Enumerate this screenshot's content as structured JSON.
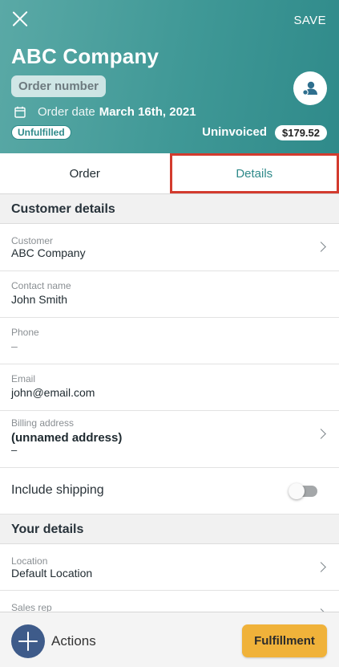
{
  "header": {
    "close_icon": "close-icon",
    "save_label": "SAVE",
    "company_name": "ABC Company",
    "order_number_label": "Order number",
    "avatar_icon": "person-icon",
    "calendar_icon": "calendar-icon",
    "order_date_label": "Order date",
    "order_date_value": "March 16th, 2021",
    "fulfillment_status": "Unfulfilled",
    "invoice_status": "Uninvoiced",
    "amount": "$179.52",
    "colors": {
      "accent": "#3f9896",
      "highlight_border": "#d33b2e"
    }
  },
  "tabs": [
    {
      "label": "Order",
      "selected": false
    },
    {
      "label": "Details",
      "selected": true
    }
  ],
  "customer_details": {
    "section_title": "Customer details",
    "customer": {
      "label": "Customer",
      "value": "ABC Company"
    },
    "contact": {
      "label": "Contact name",
      "value": "John Smith"
    },
    "phone": {
      "label": "Phone",
      "value": "–"
    },
    "email": {
      "label": "Email",
      "value": "john@email.com"
    },
    "billing": {
      "label": "Billing address",
      "title": "(unnamed address)",
      "value": "–"
    },
    "shipping": {
      "label": "Include shipping",
      "enabled": false
    }
  },
  "your_details": {
    "section_title": "Your details",
    "location": {
      "label": "Location",
      "value": "Default Location"
    },
    "sales_rep": {
      "label": "Sales rep"
    }
  },
  "bottom_bar": {
    "actions_label": "Actions",
    "fulfillment_label": "Fulfillment",
    "fulfillment_color": "#f0b23a"
  }
}
